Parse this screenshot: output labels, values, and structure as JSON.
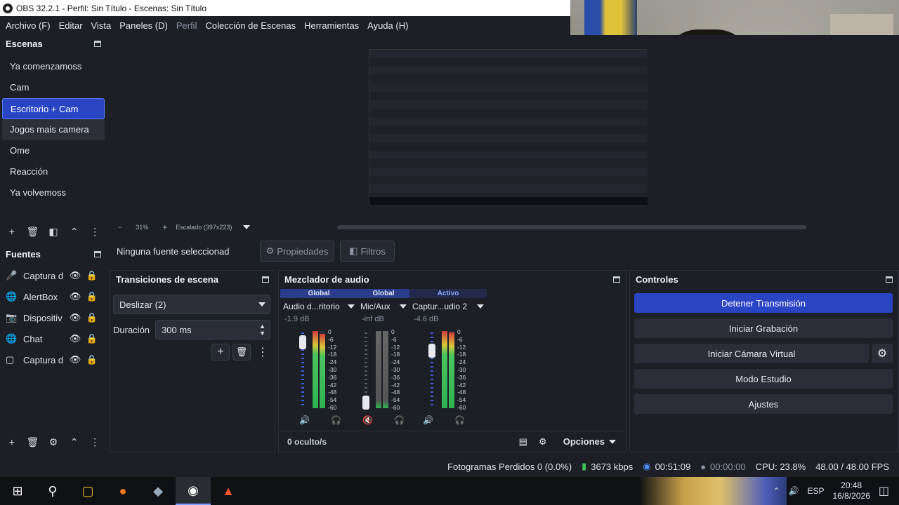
{
  "window": {
    "title": "OBS 32.2.1 - Perfil: Sin Título - Escenas: Sin Título"
  },
  "menu": [
    "Archivo (F)",
    "Editar",
    "Vista",
    "Paneles (D)",
    "Perfil",
    "Colección de Escenas",
    "Herramientas",
    "Ayuda (H)"
  ],
  "scenes": {
    "title": "Escenas",
    "items": [
      "Ya comenzamoss",
      "Cam",
      "Escritorio + Cam",
      "Jogos mais camera",
      "Ome",
      "Reacción",
      "Ya volvemoss"
    ],
    "selected": "Escritorio + Cam"
  },
  "sources": {
    "title": "Fuentes",
    "items": [
      {
        "name": "Captura d",
        "icon": "microphone-icon"
      },
      {
        "name": "AlertBox",
        "icon": "globe-icon"
      },
      {
        "name": "Dispositiv",
        "icon": "camera-icon"
      },
      {
        "name": "Chat",
        "icon": "globe-icon"
      },
      {
        "name": "Captura d",
        "icon": "monitor-icon"
      }
    ]
  },
  "preview_toolbar": {
    "zoom_minus": "−",
    "zoom": "31%",
    "zoom_plus": "+",
    "scale": "Escalado (397x223)"
  },
  "source_bar": {
    "none_selected": "Ninguna fuente seleccionad",
    "properties": "Propiedades",
    "filters": "Filtros"
  },
  "transitions": {
    "title": "Transiciones de escena",
    "selected": "Deslizar (2)",
    "duration_label": "Duración",
    "duration_value": "300 ms"
  },
  "mixer": {
    "title": "Mezclador de audio",
    "channels": [
      {
        "tag": "Global",
        "name": "Audio d...ritorio",
        "db": "-1.9 dB"
      },
      {
        "tag": "Global",
        "name": "Mic/Aux",
        "db": "-inf dB"
      },
      {
        "tag": "Activo",
        "name": "Captur...udio 2",
        "db": "-4.6 dB"
      }
    ],
    "scale": [
      "0",
      "-6",
      "-12",
      "-18",
      "-24",
      "-30",
      "-36",
      "-42",
      "-48",
      "-54",
      "-60"
    ],
    "hidden": "0 oculto/s",
    "options": "Opciones"
  },
  "controls": {
    "title": "Controles",
    "buttons": [
      "Detener Transmisión",
      "Iniciar Grabación",
      "Iniciar Cámara Virtual",
      "Modo Estudio",
      "Ajustes"
    ]
  },
  "status": {
    "dropped": "Fotogramas Perdidos 0 (0.0%)",
    "bitrate": "3673 kbps",
    "stream_time": "00:51:09",
    "rec_time": "00:00:00",
    "cpu": "CPU: 23.8%",
    "fps": "48.00 / 48.00 FPS"
  },
  "taskbar": {
    "lang": "ESP",
    "time": "20:48",
    "date": "16/8/2026"
  },
  "colors": {
    "accent": "#2a45c4",
    "bg": "#1d1f26"
  }
}
